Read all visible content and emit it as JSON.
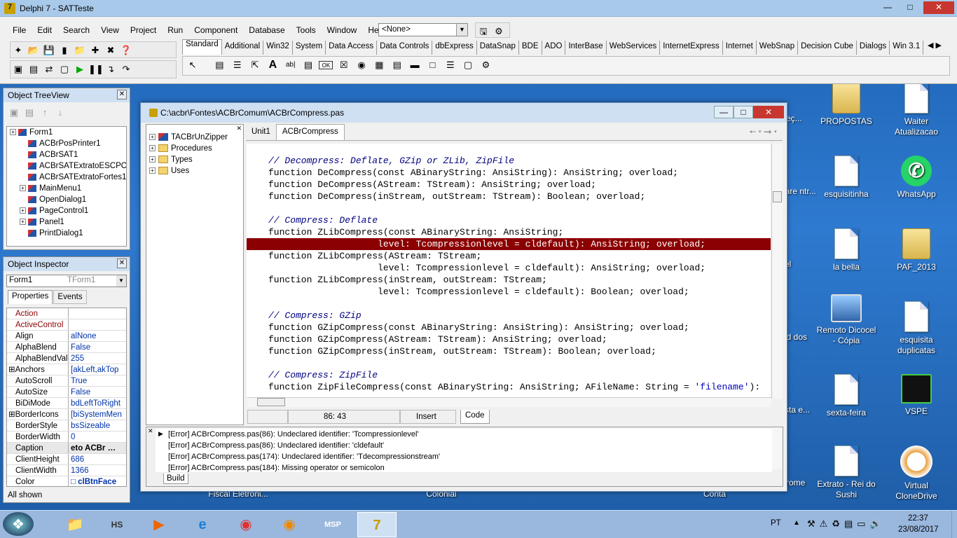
{
  "window": {
    "title": "Delphi 7 - SATTeste"
  },
  "menu": [
    "File",
    "Edit",
    "Search",
    "View",
    "Project",
    "Run",
    "Component",
    "Database",
    "Tools",
    "Window",
    "Help"
  ],
  "config_select": {
    "value": "<None>"
  },
  "palette_tabs": [
    "Standard",
    "Additional",
    "Win32",
    "System",
    "Data Access",
    "Data Controls",
    "dbExpress",
    "DataSnap",
    "BDE",
    "ADO",
    "InterBase",
    "WebServices",
    "InternetExpress",
    "Internet",
    "WebSnap",
    "Decision Cube",
    "Dialogs",
    "Win 3.1"
  ],
  "tree_view": {
    "title": "Object TreeView",
    "items": [
      "Form1",
      "ACBrPosPrinter1",
      "ACBrSAT1",
      "ACBrSATExtratoESCPO",
      "ACBrSATExtratoFortes1",
      "MainMenu1",
      "OpenDialog1",
      "PageControl1",
      "Panel1",
      "PrintDialog1"
    ]
  },
  "inspector": {
    "title": "Object Inspector",
    "object": "Form1",
    "object_type": "TForm1",
    "tabs": [
      "Properties",
      "Events"
    ],
    "rows": [
      [
        "Action",
        ""
      ],
      [
        "ActiveControl",
        ""
      ],
      [
        "Align",
        "alNone"
      ],
      [
        "AlphaBlend",
        "False"
      ],
      [
        "AlphaBlendValu",
        "255"
      ],
      [
        "Anchors",
        "[akLeft,akTop"
      ],
      [
        "AutoScroll",
        "True"
      ],
      [
        "AutoSize",
        "False"
      ],
      [
        "BiDiMode",
        "bdLeftToRight"
      ],
      [
        "BorderIcons",
        "[biSystemMen"
      ],
      [
        "BorderStyle",
        "bsSizeable"
      ],
      [
        "BorderWidth",
        "0"
      ],
      [
        "Caption",
        "eto ACBr"
      ],
      [
        "ClientHeight",
        "686"
      ],
      [
        "ClientWidth",
        "1366"
      ],
      [
        "Color",
        "clBtnFace"
      ]
    ],
    "status": "All shown"
  },
  "editor": {
    "title": "C:\\acbr\\Fontes\\ACBrComum\\ACBrCompress.pas",
    "tabs": [
      "Unit1",
      "ACBrCompress"
    ],
    "explorer": [
      "TACBrUnZipper",
      "Procedures",
      "Types",
      "Uses"
    ],
    "code": [
      {
        "t": "// Decompress: Deflate, GZip or ZLib, ZipFile",
        "c": "cm"
      },
      {
        "t": "function DeCompress(const ABinaryString: AnsiString): AnsiString; overload;",
        "c": ""
      },
      {
        "t": "function DeCompress(AStream: TStream): AnsiString; overload;",
        "c": ""
      },
      {
        "t": "function DeCompress(inStream, outStream: TStream): Boolean; overload;",
        "c": ""
      },
      {
        "t": "",
        "c": ""
      },
      {
        "t": "// Compress: Deflate",
        "c": "cm"
      },
      {
        "t": "function ZLibCompress(const ABinaryString: AnsiString;",
        "c": ""
      },
      {
        "t": "                    level: Tcompressionlevel = cldefault): AnsiString; overload;",
        "c": "errline"
      },
      {
        "t": "function ZLibCompress(AStream: TStream;",
        "c": ""
      },
      {
        "t": "                    level: Tcompressionlevel = cldefault): AnsiString; overload;",
        "c": ""
      },
      {
        "t": "function ZLibCompress(inStream, outStream: TStream;",
        "c": ""
      },
      {
        "t": "                    level: Tcompressionlevel = cldefault): Boolean; overload;",
        "c": ""
      },
      {
        "t": "",
        "c": ""
      },
      {
        "t": "// Compress: GZip",
        "c": "cm"
      },
      {
        "t": "function GZipCompress(const ABinaryString: AnsiString): AnsiString; overload;",
        "c": ""
      },
      {
        "t": "function GZipCompress(AStream: TStream): AnsiString; overload;",
        "c": ""
      },
      {
        "t": "function GZipCompress(inStream, outStream: TStream): Boolean; overload;",
        "c": ""
      },
      {
        "t": "",
        "c": ""
      },
      {
        "t": "// Compress: ZipFile",
        "c": "cm"
      },
      {
        "t": "function ZipFileCompress(const ABinaryString: AnsiString; AFileName: String = 'filename'):",
        "c": ""
      }
    ],
    "status": {
      "position": "86:  43",
      "mode": "Insert",
      "view_tab": "Code"
    },
    "messages": [
      "[Error] ACBrCompress.pas(86): Undeclared identifier: 'Tcompressionlevel'",
      "[Error] ACBrCompress.pas(86): Undeclared identifier: 'cldefault'",
      "[Error] ACBrCompress.pas(174): Undeclared identifier: 'Tdecompressionstream'",
      "[Error] ACBrCompress.pas(184): Missing operator or semicolon"
    ],
    "messages_tab": "Build"
  },
  "desktop_icons": [
    {
      "label": "PROPOSTAS",
      "kind": "folder"
    },
    {
      "label": "Waiter Atualizacao",
      "kind": "doc"
    },
    {
      "label": "esquisitinha",
      "kind": "doc"
    },
    {
      "label": "WhatsApp",
      "kind": "wa"
    },
    {
      "label": "la bella",
      "kind": "doc"
    },
    {
      "label": "PAF_2013",
      "kind": "folder"
    },
    {
      "label": "Remoto Dicocel - Cópia",
      "kind": "pc"
    },
    {
      "label": "esquisita duplicatas",
      "kind": "doc"
    },
    {
      "label": "sexta-feira",
      "kind": "doc"
    },
    {
      "label": "VSPE",
      "kind": "vspe"
    },
    {
      "label": "Extrato - Rei do Sushi",
      "kind": "doc"
    },
    {
      "label": "Virtual CloneDrive",
      "kind": "sheep"
    }
  ],
  "partial_labels": [
    "Preç...",
    "ware ntr...",
    "el",
    "id dos",
    "sta e...",
    "rome",
    "Fiscal Eletroni...",
    "Colonial",
    "Conta"
  ],
  "taskbar": {
    "language": "PT",
    "time": "22:37",
    "date": "23/08/2017"
  }
}
